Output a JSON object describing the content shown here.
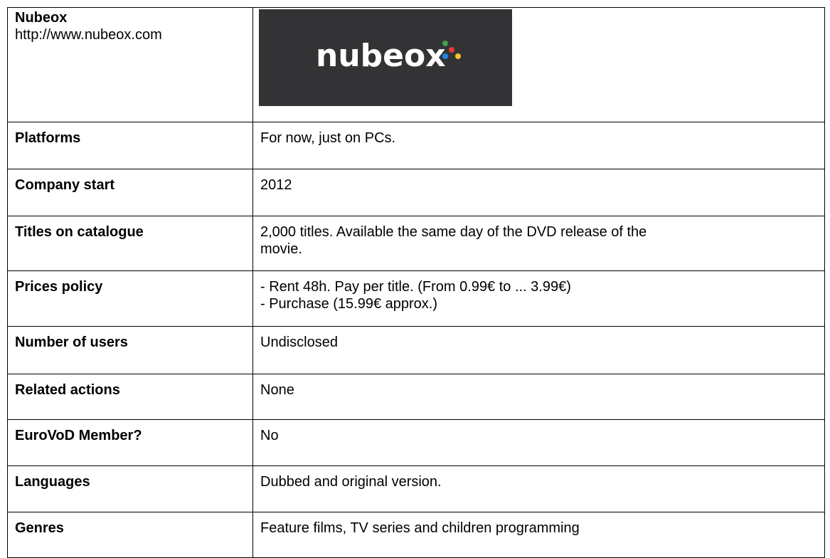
{
  "header": {
    "brand_name": "Nubeox",
    "brand_url": "http://www.nubeox.com",
    "logo_text": "nubeox",
    "logo_dot_colors": [
      "#e53935",
      "#43a047",
      "#fbc02d",
      "#1e88e5"
    ]
  },
  "rows": [
    {
      "label": "Platforms",
      "value_lines": [
        "For now, just on PCs."
      ]
    },
    {
      "label": "Company start",
      "value_lines": [
        "2012"
      ]
    },
    {
      "label": "Titles on catalogue",
      "value_lines": [
        "2,000 titles. Available the same day of the DVD release of the",
        "movie."
      ]
    },
    {
      "label": "Prices policy",
      "value_lines": [
        "- Rent 48h. Pay per title. (From 0.99€ to ... 3.99€)",
        "- Purchase (15.99€ approx.)"
      ]
    },
    {
      "label": "Number of users",
      "value_lines": [
        "Undisclosed"
      ]
    },
    {
      "label": "Related actions",
      "value_lines": [
        "None"
      ]
    },
    {
      "label": "EuroVoD Member?",
      "value_lines": [
        "No"
      ]
    },
    {
      "label": "Languages",
      "value_lines": [
        "Dubbed and original version."
      ]
    },
    {
      "label": "Genres",
      "value_lines": [
        "Feature films, TV series and children programming"
      ]
    }
  ]
}
